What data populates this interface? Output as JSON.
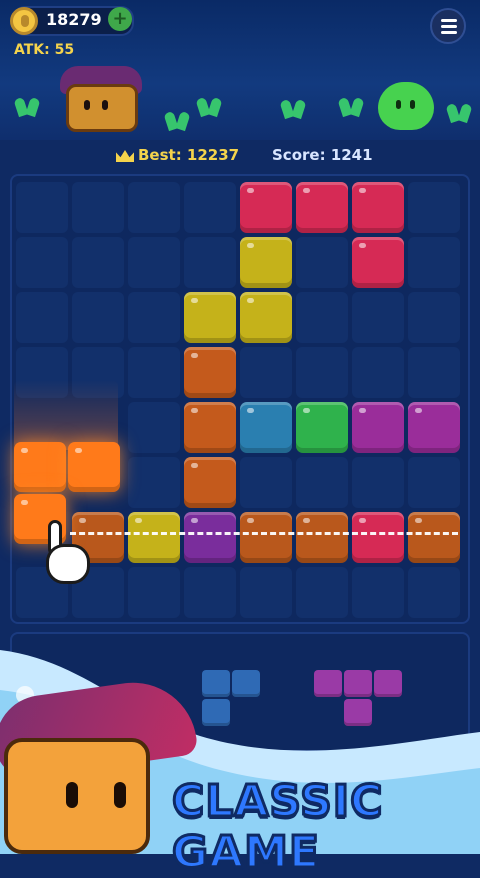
{
  "header": {
    "coins": "18279",
    "atk": "ATK: 55",
    "menu_icon": "hamburger-menu-icon"
  },
  "scoreboard": {
    "best": "Best: 12237",
    "score": "Score: 1241"
  },
  "footer": {
    "title": "CLASSIC GAME"
  },
  "colors": {
    "red": "#d62a55",
    "yellow": "#c5b21a",
    "orange": "#c45a1c",
    "teal": "#2a7fb0",
    "green": "#2fb24c",
    "purple": "#9a2d9a",
    "violet": "#7a2d9c",
    "brown": "#b9581c",
    "blue_mini": "#2f6ab5",
    "purple_mini": "#9a3aa6",
    "drag_orange": "#ff7a1a"
  }
}
